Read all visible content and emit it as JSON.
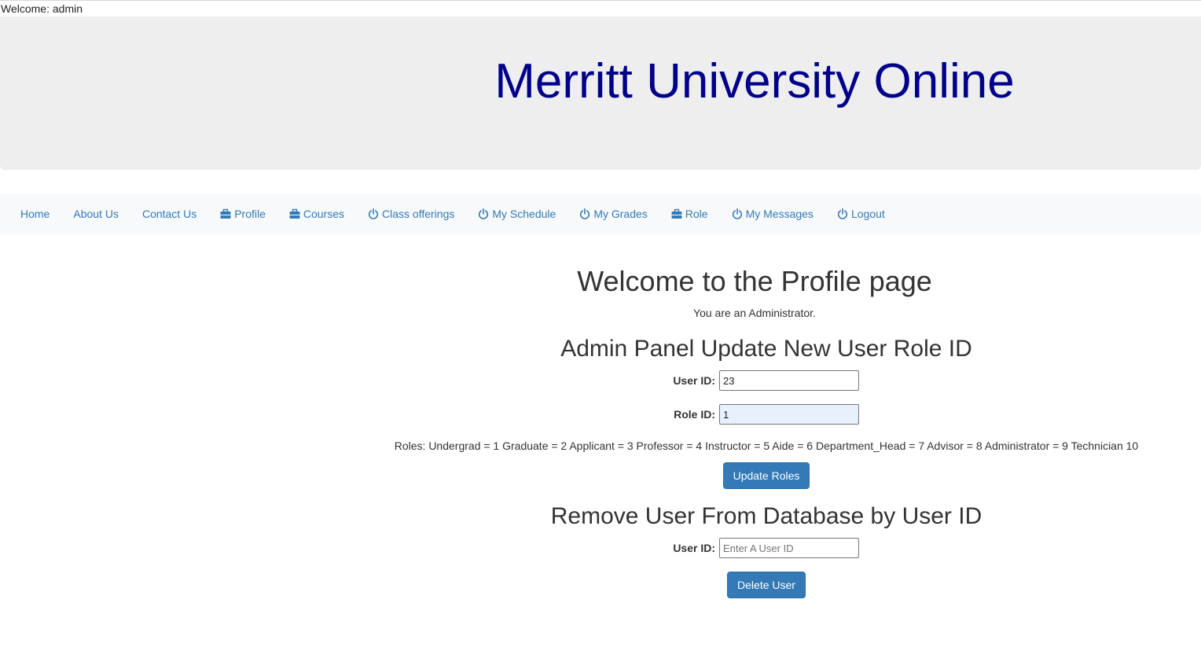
{
  "header": {
    "welcome": "Welcome: admin",
    "site_title": "Merritt University Online",
    "title_color": "#00008b"
  },
  "nav": {
    "items": [
      {
        "label": "Home",
        "icon": null
      },
      {
        "label": "About Us",
        "icon": null
      },
      {
        "label": "Contact Us",
        "icon": null
      },
      {
        "label": "Profile",
        "icon": "briefcase-icon"
      },
      {
        "label": "Courses",
        "icon": "briefcase-icon"
      },
      {
        "label": "Class offerings",
        "icon": "power-icon"
      },
      {
        "label": "My Schedule",
        "icon": "power-icon"
      },
      {
        "label": "My Grades",
        "icon": "power-icon"
      },
      {
        "label": "Role",
        "icon": "briefcase-icon"
      },
      {
        "label": "My Messages",
        "icon": "power-icon"
      },
      {
        "label": "Logout",
        "icon": "power-icon"
      }
    ],
    "link_color": "#337ab7"
  },
  "main": {
    "heading": "Welcome to the Profile page",
    "role_text": "You are an Administrator.",
    "update_section": {
      "heading": "Admin Panel Update New User Role ID",
      "user_id_label": "User ID:",
      "user_id_value": "23",
      "role_id_label": "Role ID:",
      "role_id_value": "1",
      "roles_list": "Roles: Undergrad = 1 Graduate = 2 Applicant = 3 Professor = 4 Instructor = 5 Aide = 6 Department_Head = 7 Advisor = 8 Administrator = 9 Technician 10",
      "button_label": "Update Roles"
    },
    "remove_section": {
      "heading": "Remove User From Database by User ID",
      "user_id_label": "User ID:",
      "user_id_value": "",
      "user_id_placeholder": "Enter A User ID",
      "button_label": "Delete User"
    },
    "button_color": "#337ab7"
  }
}
